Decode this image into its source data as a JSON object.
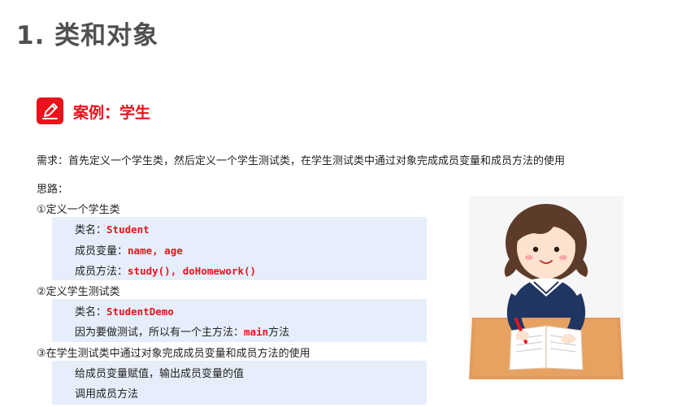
{
  "page": {
    "title": "1. 类和对象"
  },
  "case": {
    "icon": "pencil-icon",
    "title": "案例：学生"
  },
  "requirement": "需求：首先定义一个学生类，然后定义一个学生测试类，在学生测试类中通过对象完成成员变量和成员方法的使用",
  "thinking_label": "思路：",
  "steps": [
    {
      "heading": "①定义一个学生类",
      "lines": [
        {
          "label": "类名：",
          "code": "Student",
          "suffix": ""
        },
        {
          "label": "成员变量：",
          "code": "name, age",
          "suffix": ""
        },
        {
          "label": "成员方法：",
          "code": "study(), doHomework()",
          "suffix": ""
        }
      ]
    },
    {
      "heading": "②定义学生测试类",
      "lines": [
        {
          "label": "类名：",
          "code": "StudentDemo",
          "suffix": ""
        },
        {
          "label": "因为要做测试，所以有一个主方法：",
          "code": "main",
          "suffix": "方法"
        }
      ]
    },
    {
      "heading": "③在学生测试类中通过对象完成成员变量和成员方法的使用",
      "lines": [
        {
          "label": "给成员变量赋值，输出成员变量的值",
          "code": "",
          "suffix": ""
        },
        {
          "label": "调用成员方法",
          "code": "",
          "suffix": ""
        }
      ]
    }
  ],
  "colors": {
    "accent": "#e8131b",
    "title": "#505050",
    "block_bg": "#e6eefb"
  },
  "illustration": "student-girl-reading-illustration"
}
